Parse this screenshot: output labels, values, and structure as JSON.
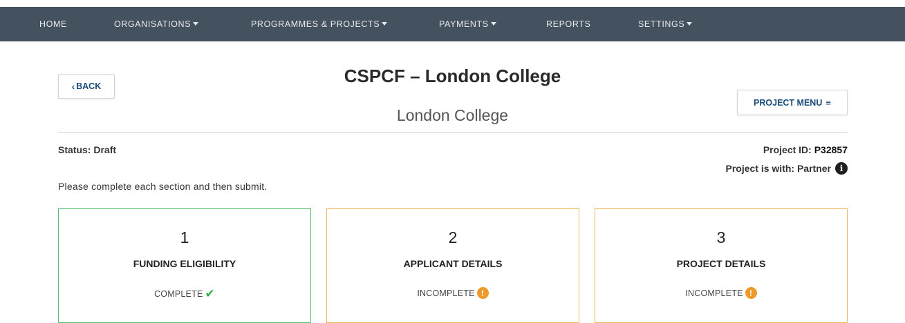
{
  "nav": {
    "items": [
      {
        "label": "HOME",
        "dropdown": false
      },
      {
        "label": "ORGANISATIONS",
        "dropdown": true
      },
      {
        "label": "PROGRAMMES & PROJECTS",
        "dropdown": true
      },
      {
        "label": "PAYMENTS",
        "dropdown": true
      },
      {
        "label": "REPORTS",
        "dropdown": false
      },
      {
        "label": "SETTINGS",
        "dropdown": true
      }
    ]
  },
  "header": {
    "back_label": "BACK",
    "title": "CSPCF – London College",
    "subtitle": "London College",
    "project_menu_label": "PROJECT MENU"
  },
  "meta": {
    "status_label": "Status:",
    "status_value": "Draft",
    "project_id_label": "Project ID:",
    "project_id_value": "P32857",
    "project_with_label": "Project is with:",
    "project_with_value": "Partner"
  },
  "instructions": "Please complete each section and then submit.",
  "sections": [
    {
      "number": "1",
      "title": "FUNDING ELIGIBILITY",
      "status": "COMPLETE"
    },
    {
      "number": "2",
      "title": "APPLICANT DETAILS",
      "status": "INCOMPLETE"
    },
    {
      "number": "3",
      "title": "PROJECT DETAILS",
      "status": "INCOMPLETE"
    }
  ],
  "icons": {
    "info": "info-circle-icon",
    "complete": "check-icon",
    "incomplete": "exclamation-circle-icon"
  },
  "colors": {
    "nav_bg": "#44525f",
    "complete_border": "#4cc36a",
    "incomplete_border": "#f0b55a",
    "check": "#2fae4e",
    "warning": "#ee9a2b",
    "link": "#1a4b7a"
  }
}
